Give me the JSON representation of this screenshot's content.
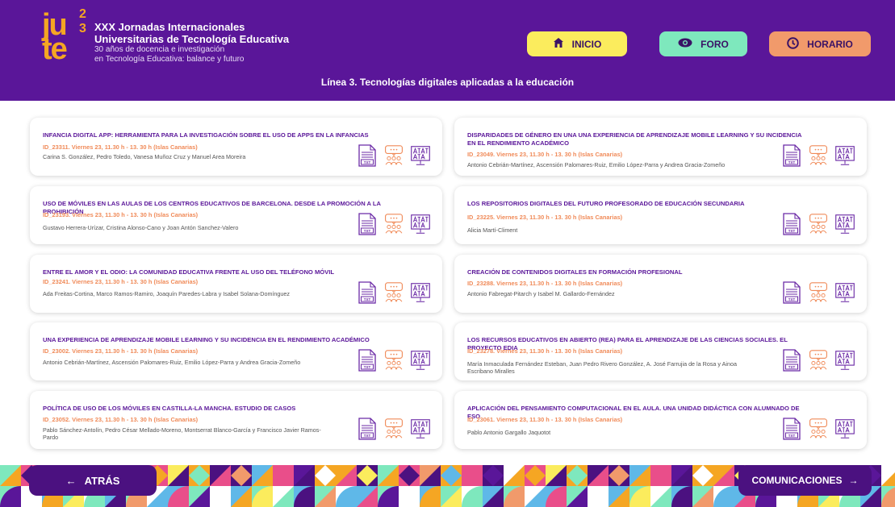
{
  "header": {
    "logo_line1": "ju",
    "logo_line2": "te",
    "logo_sup1": "2",
    "logo_sup2": "3",
    "title_line1": "XXX Jornadas Internacionales",
    "title_line2": "Universitarias de Tecnología Educativa",
    "subtitle_line1": "30 años de docencia e investigación",
    "subtitle_line2": "en Tecnología Educativa: balance y futuro",
    "section_title": "Línea 3. Tecnologías digitales aplicadas a la educación"
  },
  "nav": {
    "inicio": "INICIO",
    "foro": "FORO",
    "horario": "HORARIO"
  },
  "papers": [
    {
      "title": "INFANCIA DIGITAL APP: HERRAMIENTA PARA LA INVESTIGACIÓN SOBRE EL USO DE APPS EN LA INFANCIAS",
      "meta": "ID_23311.  Viernes 23, 11.30 h - 13. 30 h  (Islas Canarias)",
      "authors": "Carina S. González, Pedro Toledo, Vanesa Muñoz Cruz y Manuel Area Moreira"
    },
    {
      "title": "DISPARIDADES DE GÉNERO EN UNA UNA EXPERIENCIA DE APRENDIZAJE MOBILE LEARNING Y SU INCIDENCIA EN EL RENDIMIENTO ACADÉMICO",
      "meta": "ID_23049.  Viernes 23, 11.30 h - 13. 30 h  (Islas Canarias)",
      "authors": "Antonio Cebrián-Martínez, Ascensión Palomares-Ruiz, Emilio López-Parra y Andrea Gracia-Zomeño"
    },
    {
      "title": "USO DE MÓVILES EN LAS AULAS DE LOS CENTROS EDUCATIVOS DE BARCELONA. DESDE LA PROMOCIÓN A LA PROHIBICIÓN",
      "meta": "ID_23193.  Viernes 23, 11.30 h - 13. 30 h  (Islas Canarias)",
      "authors": "Gustavo Herrera-Urízar, Cristina Alonso-Cano y Joan Antón Sanchez-Valero"
    },
    {
      "title": "LOS REPOSITORIOS DIGITALES DEL FUTURO PROFESORADO DE EDUCACIÓN SECUNDARIA",
      "meta": "ID_23225.  Viernes 23, 11.30 h - 13. 30 h  (Islas Canarias)",
      "authors": "Alicia Martí-Climent"
    },
    {
      "title": "ENTRE EL AMOR Y EL ODIO: LA COMUNIDAD EDUCATIVA FRENTE AL USO DEL TELÉFONO MÓVIL",
      "meta": "ID_23241.  Viernes 23, 11.30 h - 13. 30 h  (Islas Canarias)",
      "authors": "Ada Freitas-Cortina, Marco Ramos-Ramiro, Joaquín Paredes-Labra y Isabel Solana-Domínguez"
    },
    {
      "title": "CREACIÓN DE CONTENIDOS DIGITALES EN FORMACIÓN PROFESIONAL",
      "meta": "ID_23288.  Viernes 23, 11.30 h - 13. 30 h  (Islas Canarias)",
      "authors": "Antonio Fabregat-Pitarch y Isabel M. Gallardo-Fernández"
    },
    {
      "title": "UNA EXPERIENCIA DE APRENDIZAJE MOBILE LEARNING Y SU INCIDENCIA EN EL RENDIMIENTO ACADÉMICO",
      "meta": "ID_23002.  Viernes 23, 11.30 h - 13. 30 h  (Islas Canarias)",
      "authors": "Antonio Cebrián-Martínez, Ascensión Palomares-Ruiz, Emilio López-Parra y Andrea Gracia-Zomeño"
    },
    {
      "title": "LOS RECURSOS EDUCATIVOS EN ABIERTO (REA) PARA EL APRENDIZAJE DE LAS CIENCIAS SOCIALES. EL PROYECTO EDIA",
      "meta": "ID_23278.  Viernes 23, 11.30 h - 13. 30 h  (Islas Canarias)",
      "authors": "María Inmaculada Fernández Esteban, Juan Pedro Rivero González, A. José Farrujia de la Rosa y Ainoa Escribano Miralles"
    },
    {
      "title": "POLÍTICA DE USO DE LOS MÓVILES EN CASTILLA-LA MANCHA. ESTUDIO DE CASOS",
      "meta": "ID_23052.  Viernes 23, 11.30 h - 13. 30 h  (Islas Canarias)",
      "authors": "Pablo Sánchez-Antolín, Pedro César Mellado-Moreno, Montserrat Blanco-García y Francisco Javier Ramos-Pardo"
    },
    {
      "title": "APLICACIÓN DEL PENSAMIENTO COMPUTACIONAL EN EL AULA. UNA UNIDAD DIDÁCTICA CON ALUMNADO DE ESO",
      "meta": "ID_23061.  Viernes 23, 11.30 h - 13. 30 h  (Islas Canarias)",
      "authors": "Pablo Antonio Gargallo Jaquotot"
    }
  ],
  "icons": {
    "doc": "txt-document-icon",
    "forum": "forum-chat-icon",
    "presentation": "ai-presentation-icon",
    "doc_label": "TXT"
  },
  "footer": {
    "back_label": "ATRÁS",
    "back_arrow": "←",
    "next_label": "COMUNICACIONES",
    "next_arrow": "→"
  },
  "colors": {
    "brand_purple": "#5a1699",
    "dark_purple": "#4b1180",
    "accent_orange": "#f08a58",
    "yellow": "#fbec5d",
    "mint": "#7ee8bd",
    "salmon": "#f19a6b"
  }
}
